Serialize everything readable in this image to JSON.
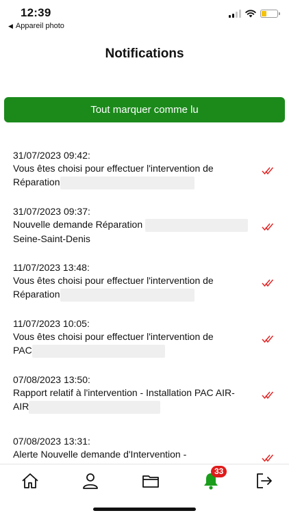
{
  "status_bar": {
    "time": "12:39",
    "back_app_label": "Appareil photo",
    "battery_level": 0.3,
    "battery_color": "#f4c20d"
  },
  "header": {
    "title": "Notifications"
  },
  "actions": {
    "mark_all_label": "Tout marquer comme lu",
    "mark_all_color": "#1b8a1b"
  },
  "notifications": [
    {
      "date": "31/07/2023 09:42:",
      "line1": "Vous êtes choisi pour effectuer l'intervention de",
      "line2": "Réparation",
      "read": true
    },
    {
      "date": "31/07/2023 09:37:",
      "line1": "Nouvelle demande Réparation",
      "line2": "Seine-Saint-Denis",
      "read": true
    },
    {
      "date": "11/07/2023 13:48:",
      "line1": "Vous êtes choisi pour effectuer l'intervention de",
      "line2": "Réparation",
      "read": true
    },
    {
      "date": "11/07/2023 10:05:",
      "line1": "Vous êtes choisi pour effectuer l'intervention de",
      "line2": "PAC",
      "read": true
    },
    {
      "date": "07/08/2023 13:50:",
      "line1": "Rapport relatif à l'intervention - Installation PAC AIR-",
      "line2": "AIR",
      "read": true
    },
    {
      "date": "07/08/2023 13:31:",
      "line1": "Alerte Nouvelle demande d'Intervention -",
      "line2": "",
      "read": true
    }
  ],
  "bottom_nav": {
    "items": [
      "home-icon",
      "profile-icon",
      "folder-icon",
      "bell-icon",
      "logout-icon"
    ],
    "active": "bell-icon",
    "active_color": "#1b9e1b",
    "notification_count": "33",
    "badge_color": "#e01b1b"
  }
}
